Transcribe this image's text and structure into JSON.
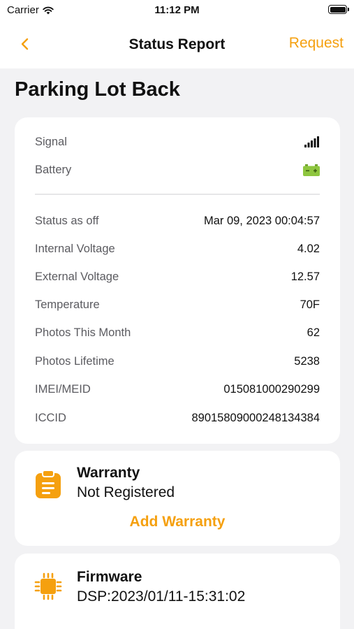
{
  "status_bar": {
    "carrier": "Carrier",
    "time": "11:12 PM"
  },
  "nav": {
    "back_icon": "chevron-left-icon",
    "title": "Status Report",
    "request_label": "Request"
  },
  "page": {
    "title": "Parking Lot Back"
  },
  "status": {
    "signal_label": "Signal",
    "signal_icon": "signal-bars-icon",
    "battery_label": "Battery",
    "battery_icon": "battery-icon",
    "rows": [
      {
        "label": "Status as off",
        "value": "Mar 09, 2023 00:04:57"
      },
      {
        "label": "Internal Voltage",
        "value": "4.02"
      },
      {
        "label": "External Voltage",
        "value": "12.57"
      },
      {
        "label": "Temperature",
        "value": "70F"
      },
      {
        "label": "Photos This Month",
        "value": "62"
      },
      {
        "label": "Photos Lifetime",
        "value": "5238"
      },
      {
        "label": "IMEI/MEID",
        "value": "015081000290299"
      },
      {
        "label": "ICCID",
        "value": "89015809000248134384"
      }
    ]
  },
  "warranty": {
    "icon": "clipboard-icon",
    "title": "Warranty",
    "status": "Not Registered",
    "action": "Add Warranty"
  },
  "firmware": {
    "icon": "chip-icon",
    "title": "Firmware",
    "version": "DSP:2023/01/11-15:31:02"
  },
  "colors": {
    "accent": "#f5a00f",
    "background": "#f2f2f4",
    "card": "#ffffff",
    "battery_green": "#8ec63f"
  }
}
